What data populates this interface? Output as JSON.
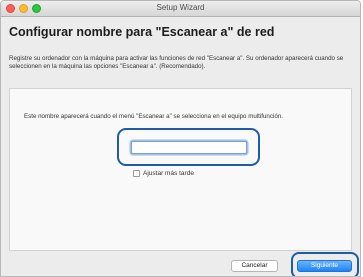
{
  "window": {
    "title": "Setup Wizard"
  },
  "page": {
    "heading": "Configurar nombre para \"Escanear a\" de red",
    "intro": "Registre su ordenador con la máquina para activar  las funciones de red \"Escanear a\". Su ordenador aparecerá cuando se seleccionen en la máquina las opciones \"Escanear a\". (Recomendado)."
  },
  "panel": {
    "description": "Este nombre aparecerá cuando el menú \"Escanear a\" se selecciona en el equipo multifunción.",
    "name_field": {
      "value": "",
      "placeholder": ""
    },
    "later_checkbox": {
      "label": "Ajustar más tarde",
      "checked": false
    }
  },
  "footer": {
    "cancel_label": "Cancelar",
    "next_label": "Siguiente"
  },
  "colors": {
    "highlight_ring": "#1f5ba7",
    "primary_button": "#1c86f4"
  }
}
